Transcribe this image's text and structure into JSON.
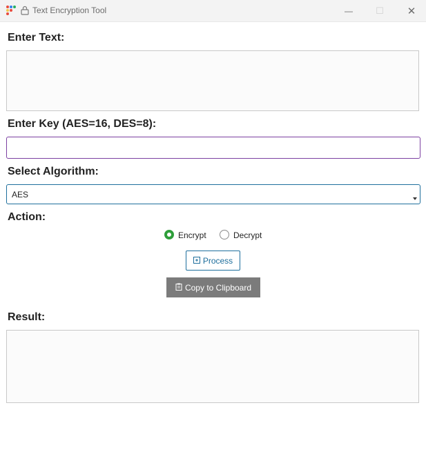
{
  "window": {
    "title": "Text Encryption Tool",
    "minimize_glyph": "—",
    "maximize_glyph": "☐",
    "close_glyph": "✕"
  },
  "input": {
    "label": "Enter Text:",
    "value": ""
  },
  "key": {
    "label": "Enter Key (AES=16, DES=8):",
    "value": "",
    "border_color": "#7b3fa1"
  },
  "algorithm": {
    "label": "Select Algorithm:",
    "selected": "AES"
  },
  "action": {
    "label": "Action:",
    "options": [
      {
        "label": "Encrypt",
        "checked": true
      },
      {
        "label": "Decrypt",
        "checked": false
      }
    ],
    "selected_color": "#2e9e3a"
  },
  "buttons": {
    "process_label": "Process",
    "copy_label": "Copy to Clipboard",
    "accent_color": "#1d6e9c",
    "copy_bg": "#7b7b7b"
  },
  "result": {
    "label": "Result:",
    "value": ""
  },
  "icons": {
    "app": "app-grid-icon",
    "lock": "lock-icon",
    "process": "process-icon",
    "copy": "clipboard-icon"
  }
}
